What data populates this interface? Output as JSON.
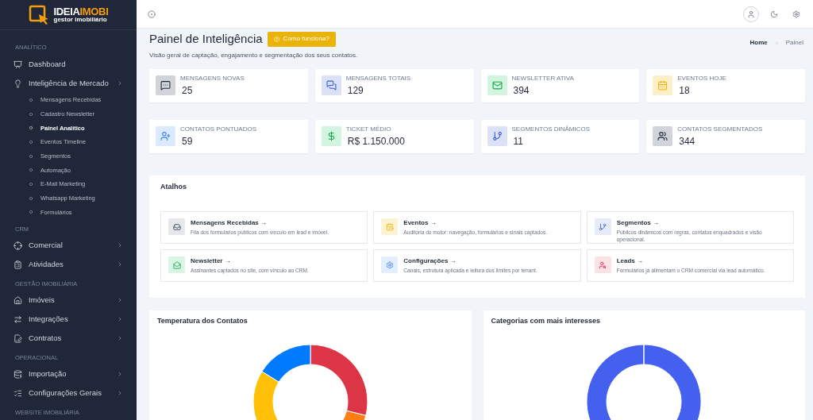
{
  "logo": {
    "name_start": "IDEIA",
    "name_end": "IMOBI",
    "tagline": "gestor imobiliário"
  },
  "sidebar": {
    "sections": [
      {
        "label": "ANALÍTICO",
        "items": [
          {
            "label": "Dashboard",
            "kind": "link"
          },
          {
            "label": "Inteligência de Mercado",
            "kind": "menu",
            "children": [
              {
                "label": "Mensagens Recebidas",
                "selected": false
              },
              {
                "label": "Cadastro Newsletter",
                "selected": false
              },
              {
                "label": "Painel Analítico",
                "selected": true
              },
              {
                "label": "Eventos Timeline",
                "selected": false
              },
              {
                "label": "Segmentos",
                "selected": false
              },
              {
                "label": "Automação",
                "selected": false
              },
              {
                "label": "E-Mail Marketing",
                "selected": false
              },
              {
                "label": "Whatsapp Marketing",
                "selected": false
              },
              {
                "label": "Formulários",
                "selected": false
              }
            ]
          }
        ]
      },
      {
        "label": "CRM",
        "items": [
          {
            "label": "Comercial",
            "kind": "menu"
          },
          {
            "label": "Atividades",
            "kind": "menu"
          }
        ]
      },
      {
        "label": "GESTÃO IMOBILIÁRIA",
        "items": [
          {
            "label": "Imóveis",
            "kind": "menu"
          },
          {
            "label": "Integrações",
            "kind": "menu"
          },
          {
            "label": "Contratos",
            "kind": "menu"
          }
        ]
      },
      {
        "label": "OPERACIONAL",
        "items": [
          {
            "label": "Importação",
            "kind": "menu"
          },
          {
            "label": "Configurações Gerais",
            "kind": "menu"
          }
        ]
      },
      {
        "label": "WEBSITE IMOBILIÁRIA"
      }
    ]
  },
  "page": {
    "title": "Painel de Inteligência",
    "help_button": "Como funciona?",
    "subtitle": "Visão geral de captação, engajamento e segmentação dos seus contatos.",
    "breadcrumb": [
      {
        "label": "Home",
        "current": false
      },
      {
        "label": "Painel",
        "current": true
      }
    ]
  },
  "stats": [
    {
      "label": "MENSAGENS NOVAS",
      "value": "25"
    },
    {
      "label": "MENSAGENS TOTAIS",
      "value": "129"
    },
    {
      "label": "NEWSLETTER ATIVA",
      "value": "394"
    },
    {
      "label": "EVENTOS HOJE",
      "value": "18"
    },
    {
      "label": "CONTATOS PONTUADOS",
      "value": "59"
    },
    {
      "label": "TICKET MÉDIO",
      "value": "R$ 1.150.000"
    },
    {
      "label": "SEGMENTOS DINÂMICOS",
      "value": "11"
    },
    {
      "label": "CONTATOS SEGMENTADOS",
      "value": "344"
    }
  ],
  "shortcuts": {
    "title": "Atalhos",
    "items": [
      {
        "title": "Mensagens Recebidas →",
        "description": "Fila dos formulários públicos com vínculo em lead e imóvel."
      },
      {
        "title": "Eventos →",
        "description": "Auditoria do motor: navegação, formulários e sinais captados."
      },
      {
        "title": "Segmentos →",
        "description": "Públicos dinâmicos com regras, contatos enquadrados e visão operacional."
      },
      {
        "title": "Newsletter →",
        "description": "Assinantes captados no site, com vínculo ao CRM."
      },
      {
        "title": "Configurações →",
        "description": "Canais, estrutura aplicada e leitura dos limites por tenant."
      },
      {
        "title": "Leads →",
        "description": "Formulários já alimentam o CRM comercial via lead automático."
      }
    ]
  },
  "charts": [
    {
      "title": "Temperatura dos Contatos",
      "kind": "multi"
    },
    {
      "title": "Categorias com mais interesses",
      "kind": "single"
    }
  ]
}
